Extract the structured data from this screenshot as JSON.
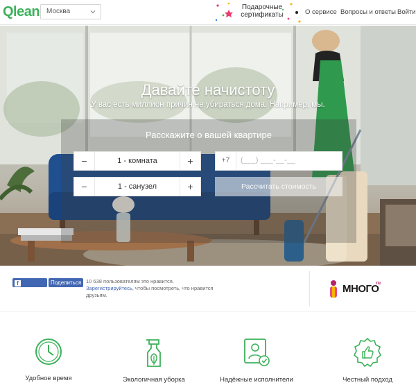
{
  "header": {
    "logo": "Qlean",
    "city": "Москва",
    "gift": "Подарочные сертификаты",
    "nav": [
      "О сервисе",
      "Вопросы и ответы",
      "Войти"
    ]
  },
  "hero": {
    "title": "Давайте начистоту",
    "subtitle": "У вас есть миллион причин не убираться дома. Например, мы.",
    "form_title": "Расскажите о вашей квартире",
    "rooms": "1 - комната",
    "bathrooms": "1 - санузел",
    "minus": "−",
    "plus": "+",
    "phone_prefix": "+7",
    "phone_mask": "(___) ___-__-__",
    "calc_button": "Рассчитать стоимость"
  },
  "social": {
    "like": "Нравится",
    "share": "Поделиться",
    "count_text": "10 638 пользователям это нравится.",
    "register_link": "Зарегистрируйтесь",
    "register_rest": ", чтобы посмотреть, что нравится друзьям.",
    "partner": "МНОГО",
    "partner_sup": "ru"
  },
  "features": [
    {
      "label": "Удобное время",
      "icon": "clock-icon"
    },
    {
      "label": "Экологичная уборка",
      "icon": "spray-bottle-icon"
    },
    {
      "label": "Надёжные исполнители",
      "icon": "verified-person-icon"
    },
    {
      "label": "Честный подход",
      "icon": "thumbs-up-badge-icon"
    }
  ],
  "colors": {
    "brand_green": "#3cb15a",
    "facebook_blue": "#4267b2",
    "mnogo_pink": "#b3246b"
  }
}
